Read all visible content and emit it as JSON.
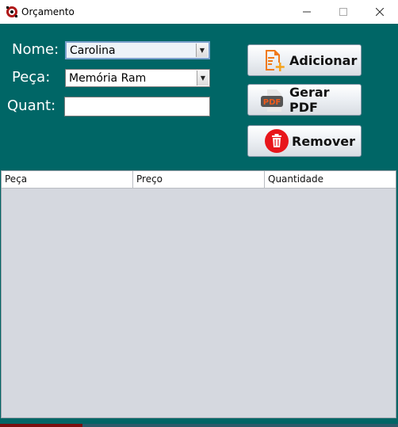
{
  "window": {
    "title": "Orçamento",
    "app_icon": "app-logo-icon",
    "min_icon": "minimize-icon",
    "max_icon": "maximize-icon",
    "close_icon": "close-icon"
  },
  "form": {
    "nome_label": "Nome:",
    "nome_value": "Carolina",
    "peca_label": "Peça:",
    "peca_value": "Memória Ram",
    "quant_label": "Quant:",
    "quant_value": ""
  },
  "buttons": {
    "adicionar": "Adicionar",
    "gerar_pdf": "Gerar PDF",
    "remover": "Remover",
    "pdf_badge": "PDF"
  },
  "table": {
    "columns": [
      "Peça",
      "Preço",
      "Quantidade"
    ],
    "rows": []
  },
  "colors": {
    "panel": "#006666",
    "table_bg": "#d5d8df",
    "remove_red": "#e8161b",
    "pdf_orange": "#f05a1a"
  }
}
